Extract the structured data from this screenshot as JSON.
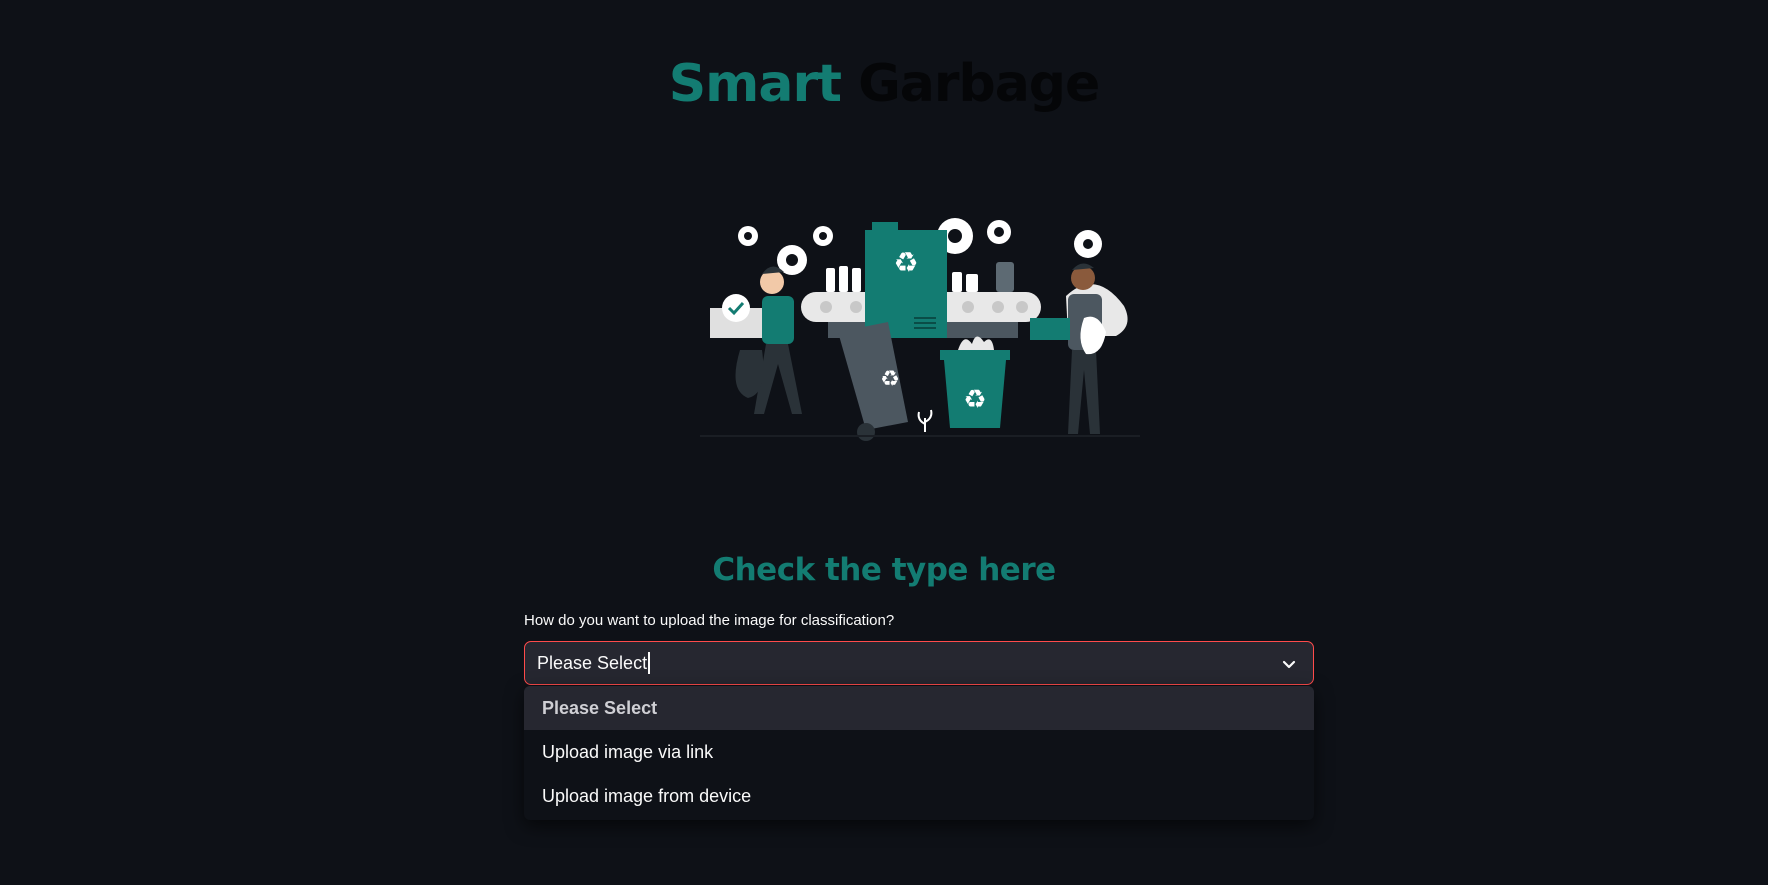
{
  "header": {
    "title_part1": "Smart",
    "title_part2": "Garbage"
  },
  "hero": {
    "icon": "recycling-illustration"
  },
  "main": {
    "subheading": "Check the type here",
    "upload_question": "How do you want to upload the image for classification?",
    "select": {
      "value": "Please Select",
      "options": [
        "Please Select",
        "Upload image via link",
        "Upload image from device"
      ],
      "selected_index": 0
    }
  },
  "colors": {
    "accent": "#137c72",
    "background": "#0e1117",
    "input_bg": "#262730",
    "focus_border": "#ff4b4b"
  }
}
